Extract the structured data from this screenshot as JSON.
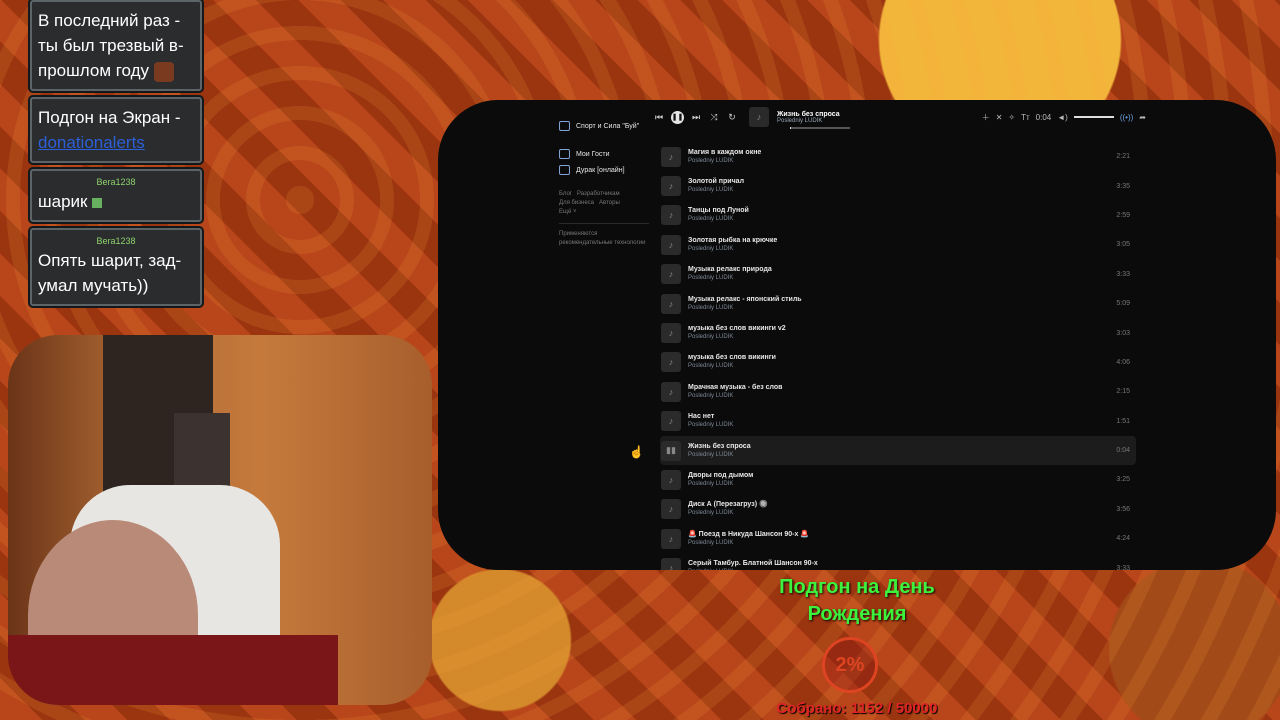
{
  "chat": [
    {
      "user": "",
      "text": "В последний раз - ты был трезвый в-прошлом году",
      "emote": "face-emote"
    },
    {
      "user": "",
      "text": "Подгон на Экран - ",
      "link": "donationalerts"
    },
    {
      "user": "Bera1238",
      "text": "шарик",
      "emote": "ball-emote"
    },
    {
      "user": "Bera1238",
      "text": "Опять шарит, зад-умал мучать))"
    }
  ],
  "sidebar": {
    "items": [
      "Спорт и Сила \"Буй\"",
      "Мои Гости",
      "Дурак [онлайн]"
    ],
    "footer_links": [
      "Блог",
      "Разработчикам",
      "Для бизнеса",
      "Авторы",
      "Ещё"
    ],
    "note": "Применяются рекомендательные технологии"
  },
  "player": {
    "now_title": "Жизнь без спроса",
    "now_artist": "Posledniy LUDIK",
    "time": "0:04",
    "progress": 0.02,
    "icons": [
      "prev-icon",
      "pause-icon",
      "next-icon",
      "shuffle-icon",
      "repeat-icon"
    ],
    "right_icons": [
      "add-icon",
      "dislike-icon",
      "magic-icon",
      "text-icon",
      "volume-icon",
      "broadcast-icon",
      "share-icon"
    ],
    "text_icon": "Tт"
  },
  "tracks": [
    {
      "title": "Магия в каждом окне",
      "artist": "Posledniy LUDIK",
      "duration": "2:21"
    },
    {
      "title": "Золотой причал",
      "artist": "Posledniy LUDIK",
      "duration": "3:35"
    },
    {
      "title": "Танцы под Луной",
      "artist": "Posledniy LUDIK",
      "duration": "2:59"
    },
    {
      "title": "Золотая рыбка на крючке",
      "artist": "Posledniy LUDIK",
      "duration": "3:05"
    },
    {
      "title": "Музыка релакс природа",
      "artist": "Posledniy LUDIK",
      "duration": "3:33"
    },
    {
      "title": "Музыка релакс - японский стиль",
      "artist": "Posledniy LUDIK",
      "duration": "5:09"
    },
    {
      "title": "музыка без слов викинги v2",
      "artist": "Posledniy LUDIK",
      "duration": "3:03"
    },
    {
      "title": "музыка без слов викинги",
      "artist": "Posledniy LUDIK",
      "duration": "4:06"
    },
    {
      "title": "Мрачная музыка - без слов",
      "artist": "Posledniy LUDIK",
      "duration": "2:15"
    },
    {
      "title": "Нас нет",
      "artist": "Posledniy LUDIK",
      "duration": "1:51"
    },
    {
      "title": "Жизнь без спроса",
      "artist": "Posledniy LUDIK",
      "duration": "0:04",
      "active": true
    },
    {
      "title": "Дворы под дымом",
      "artist": "Posledniy LUDIK",
      "duration": "3:25"
    },
    {
      "title": "Диск А (Перезагруз) 🔘",
      "artist": "Posledniy LUDIK",
      "duration": "3:56"
    },
    {
      "title": "🚨 Поезд в Никуда Шансон 90-х 🚨",
      "artist": "Posledniy LUDIK",
      "duration": "4:24"
    },
    {
      "title": "Серый Тамбур. Блатной Шансон 90-х",
      "artist": "Posledniy LUDIK",
      "duration": "3:33"
    }
  ],
  "goal": {
    "title": "Подгон на День Рождения",
    "percent_text": "2%",
    "percent": 0.02,
    "collected": "Собрано: 1152 / 50000",
    "color": "#3cf23c"
  }
}
